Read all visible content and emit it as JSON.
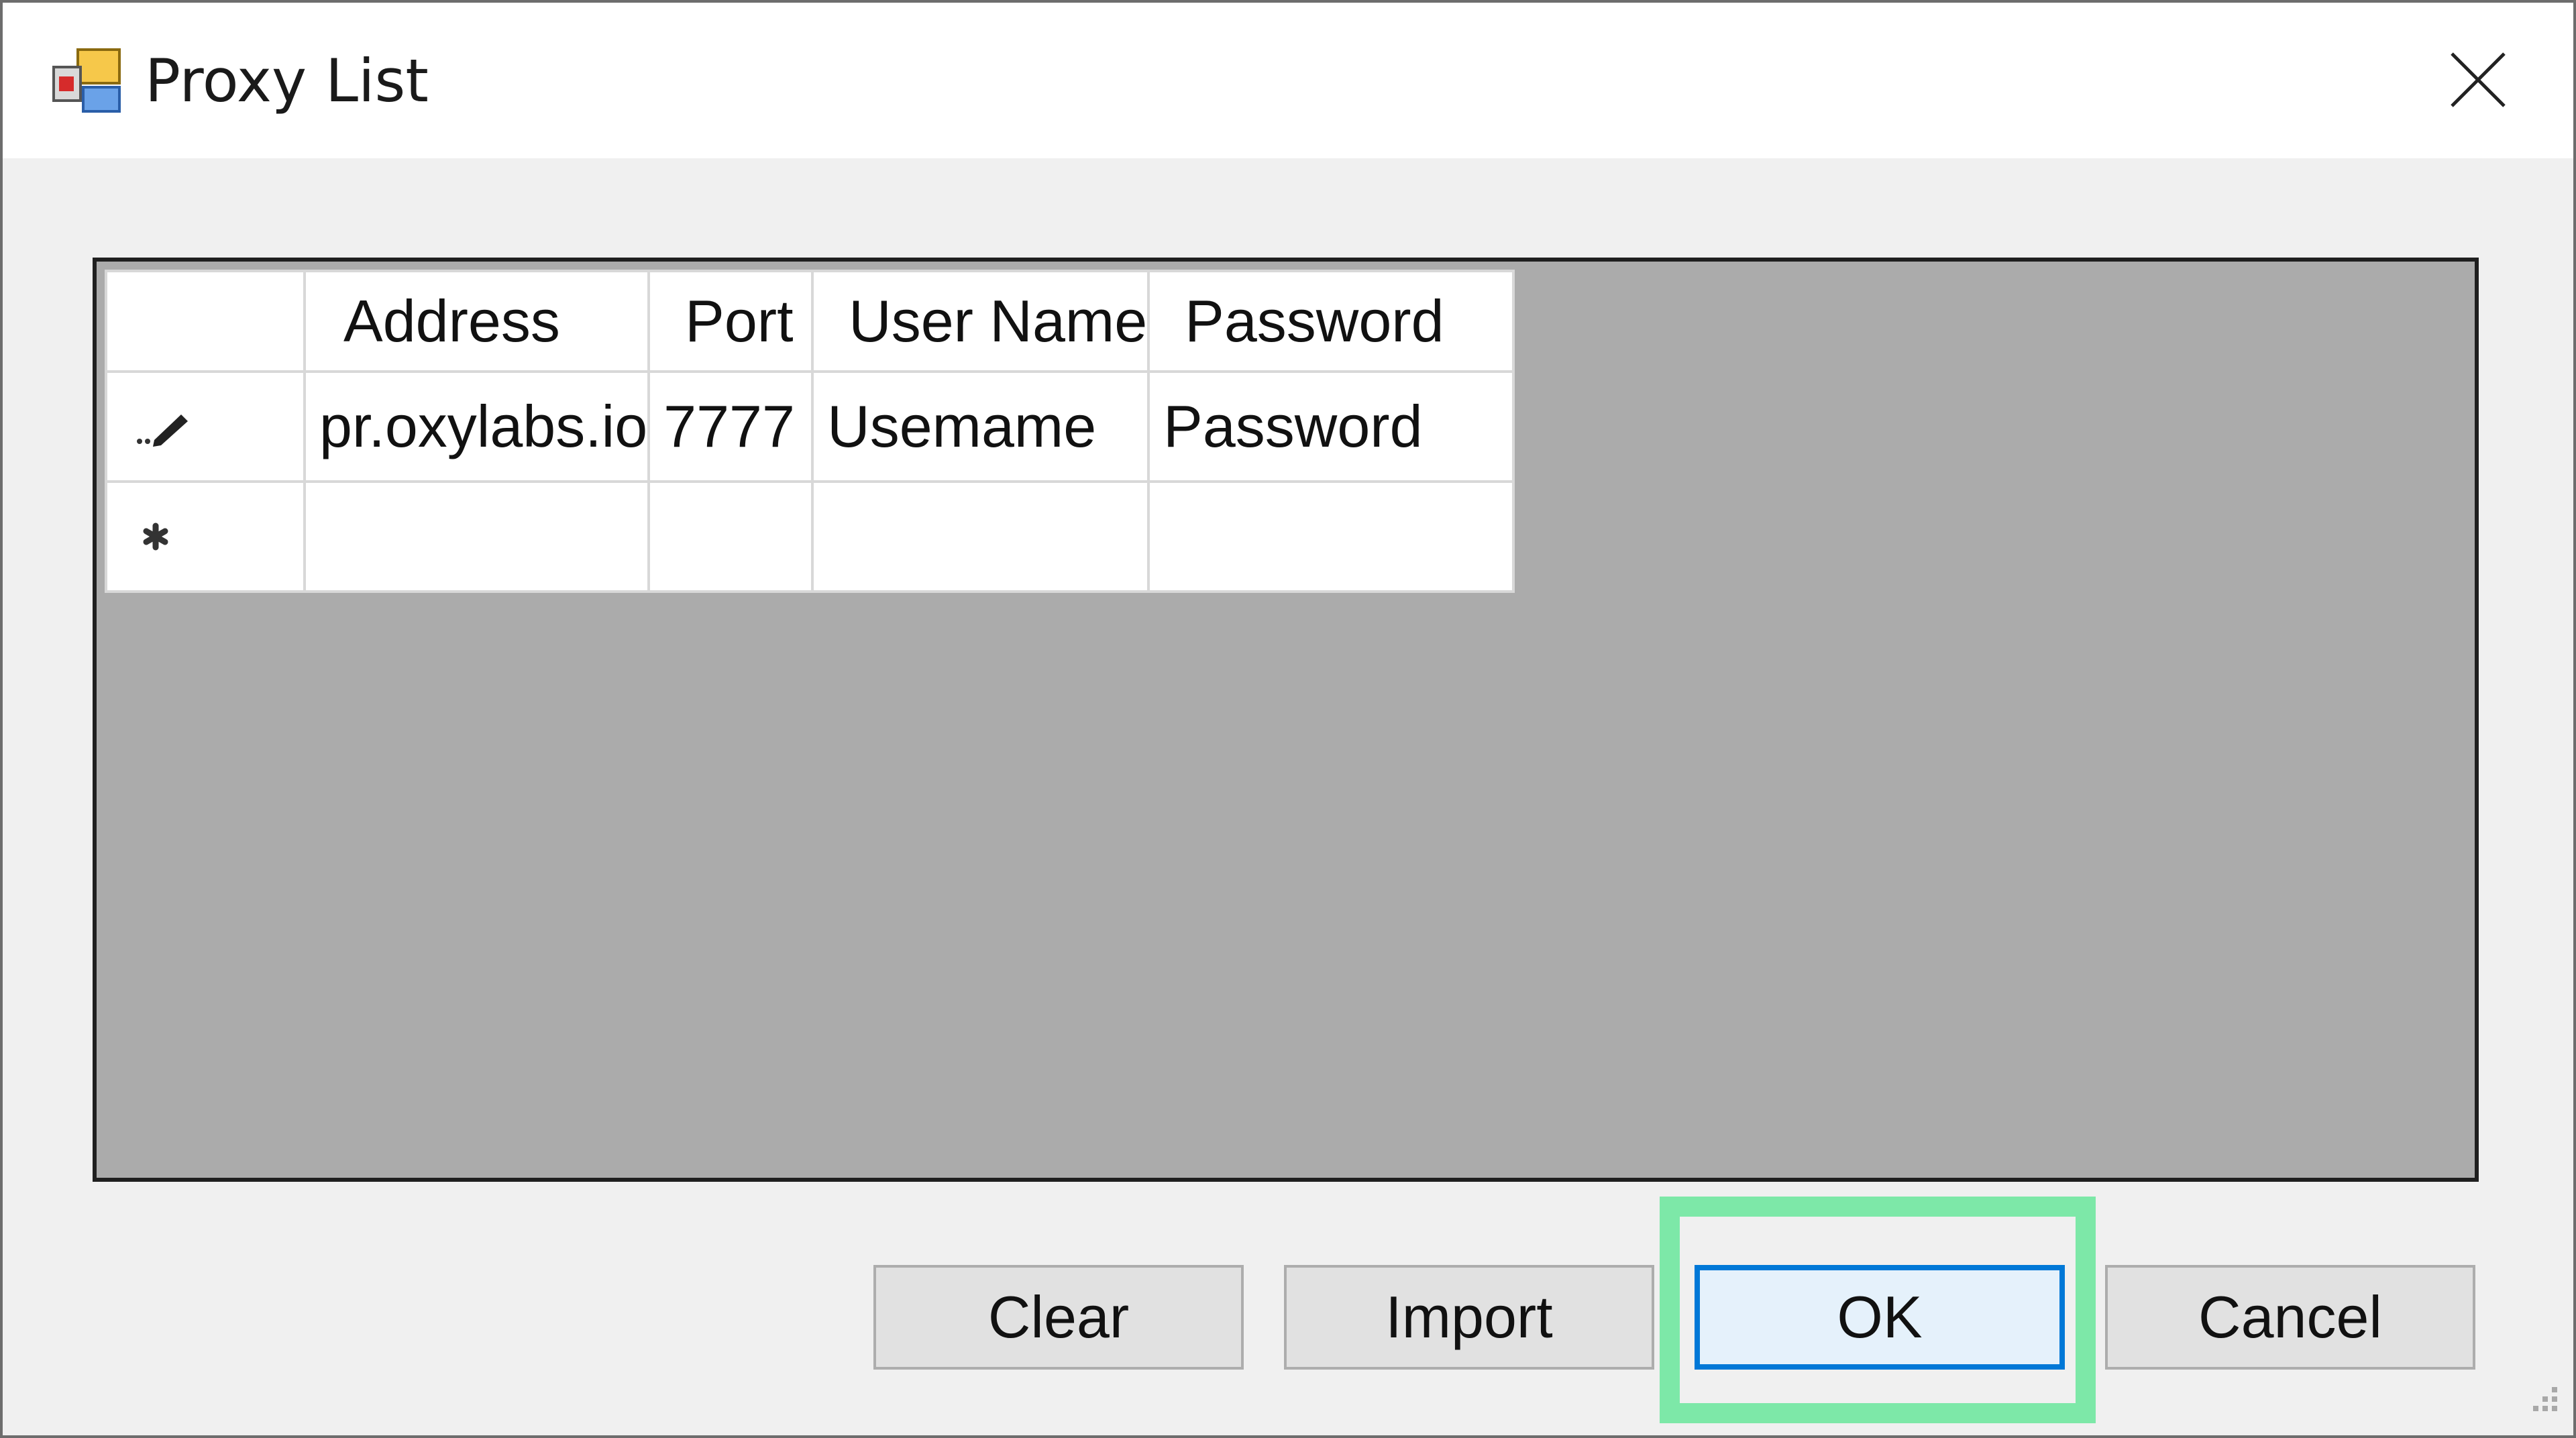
{
  "window": {
    "title": "Proxy List",
    "icon": "app-window-icon",
    "close_icon": "close-icon"
  },
  "grid": {
    "columns": [
      "Address",
      "Port",
      "User Name",
      "Password"
    ],
    "rows": [
      {
        "row_marker_icon": "pencil-edit-icon",
        "address": "pr.oxylabs.io",
        "port": "7777",
        "username": "Usemame",
        "password": "Password"
      },
      {
        "row_marker_icon": "asterisk-new-row-icon",
        "address": "",
        "port": "",
        "username": "",
        "password": ""
      }
    ],
    "colors": {
      "background": "#ababab",
      "border": "#1f1f1f"
    }
  },
  "buttons": {
    "clear": "Clear",
    "import": "Import",
    "ok": "OK",
    "cancel": "Cancel"
  },
  "colors": {
    "ok_focus_border": "#0078d7",
    "highlight": "#7de8a8"
  }
}
